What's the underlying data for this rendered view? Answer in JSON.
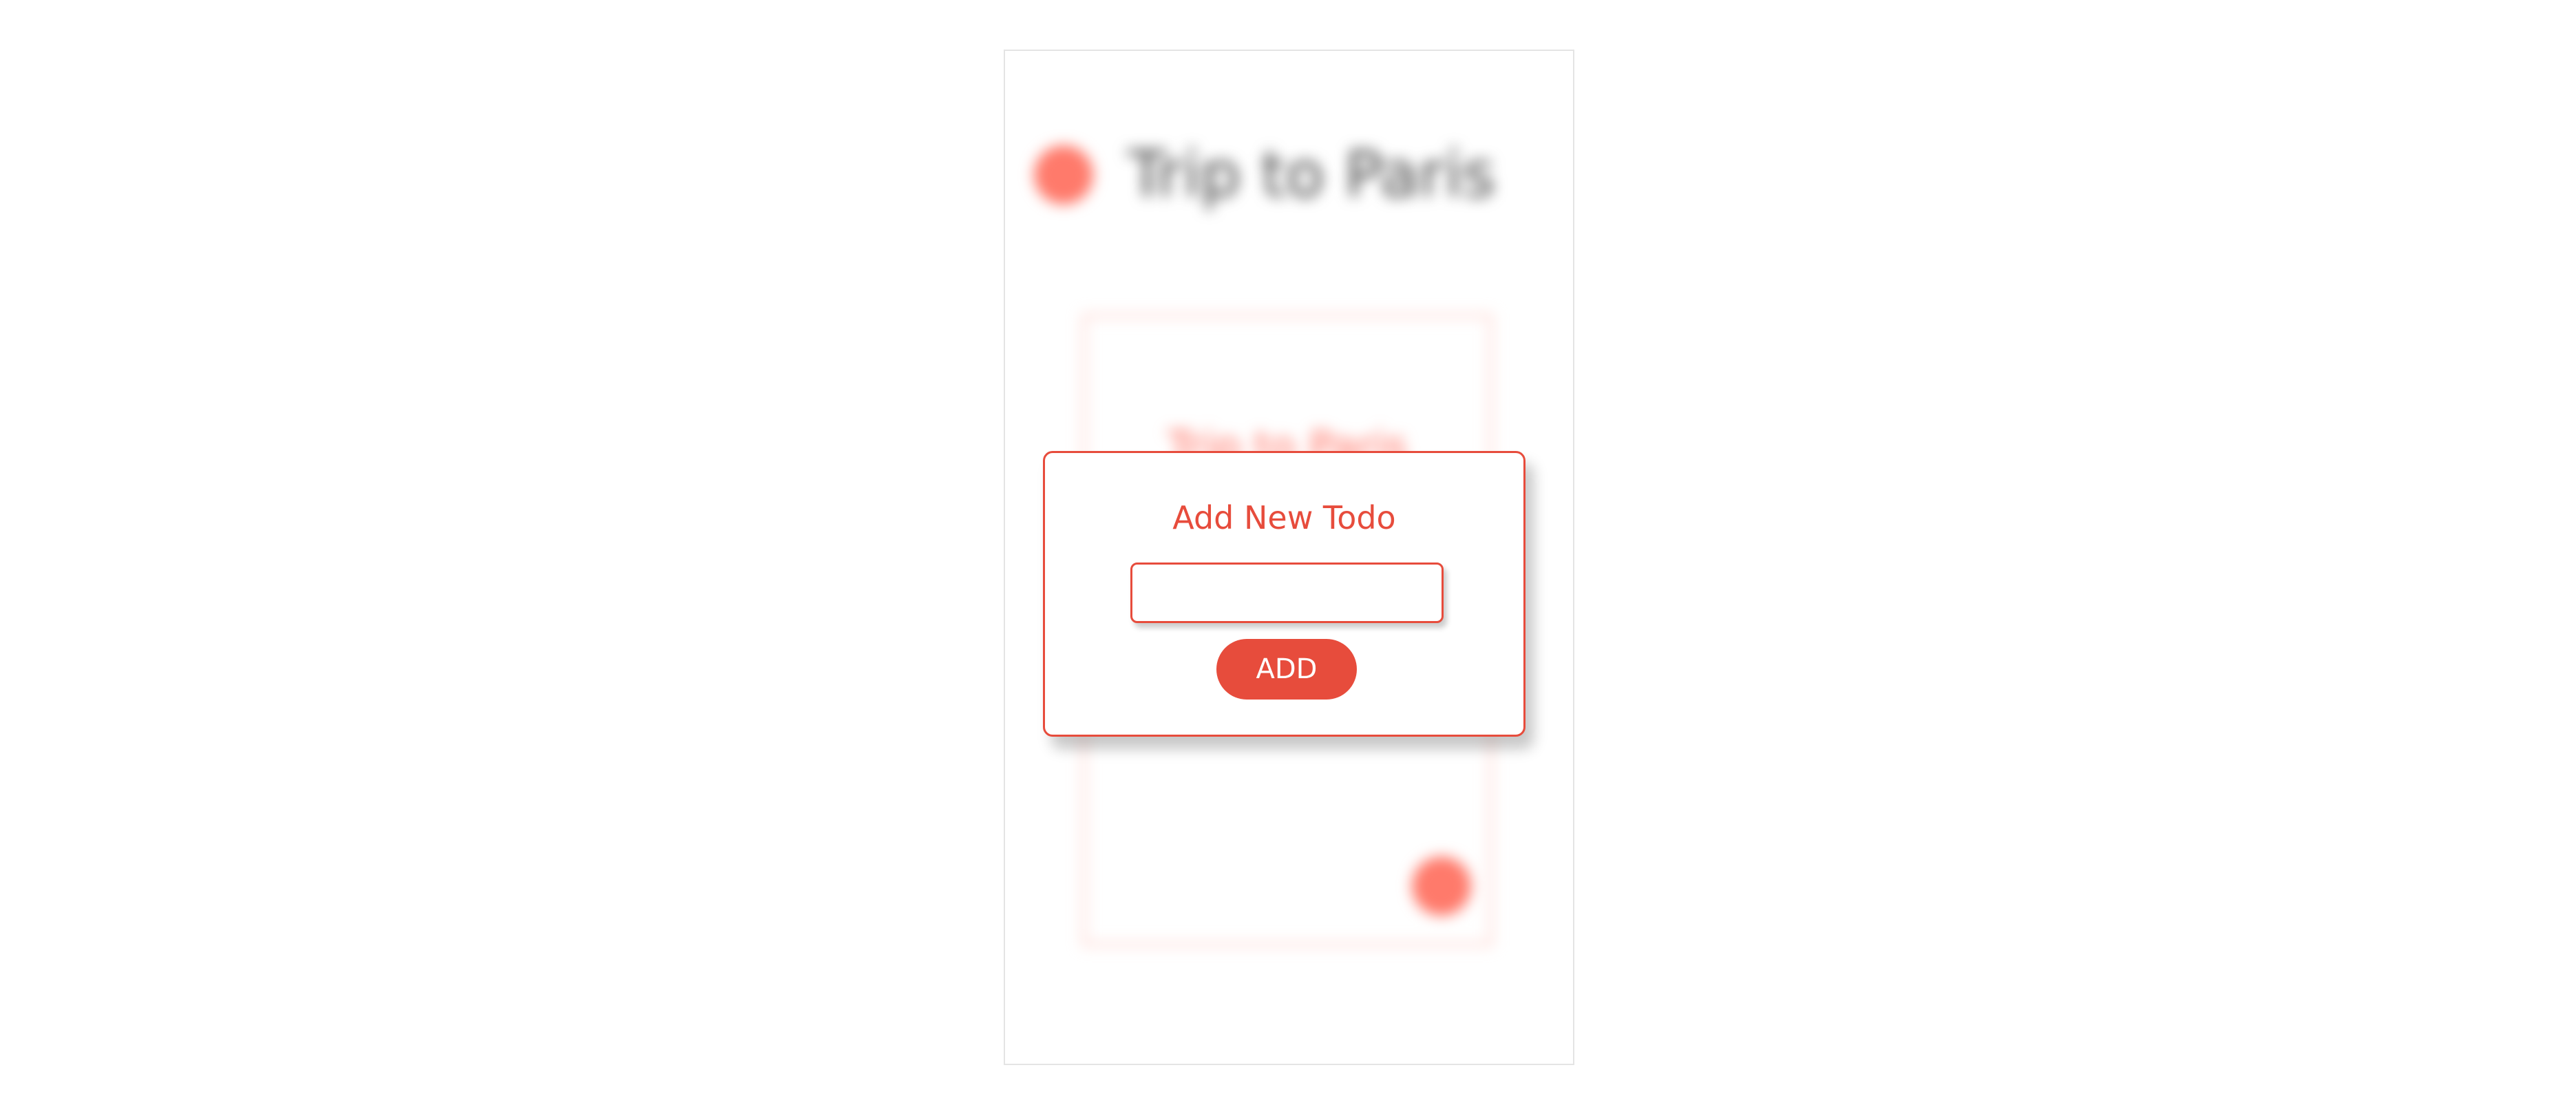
{
  "background": {
    "header_title": "Trip to Paris",
    "card_title": "Trip to Paris"
  },
  "modal": {
    "title": "Add New Todo",
    "input_value": "",
    "input_placeholder": "",
    "add_button_label": "ADD"
  },
  "colors": {
    "accent": "#e74c3c",
    "accent_light": "#ff7a6b",
    "background": "#ffffff"
  }
}
